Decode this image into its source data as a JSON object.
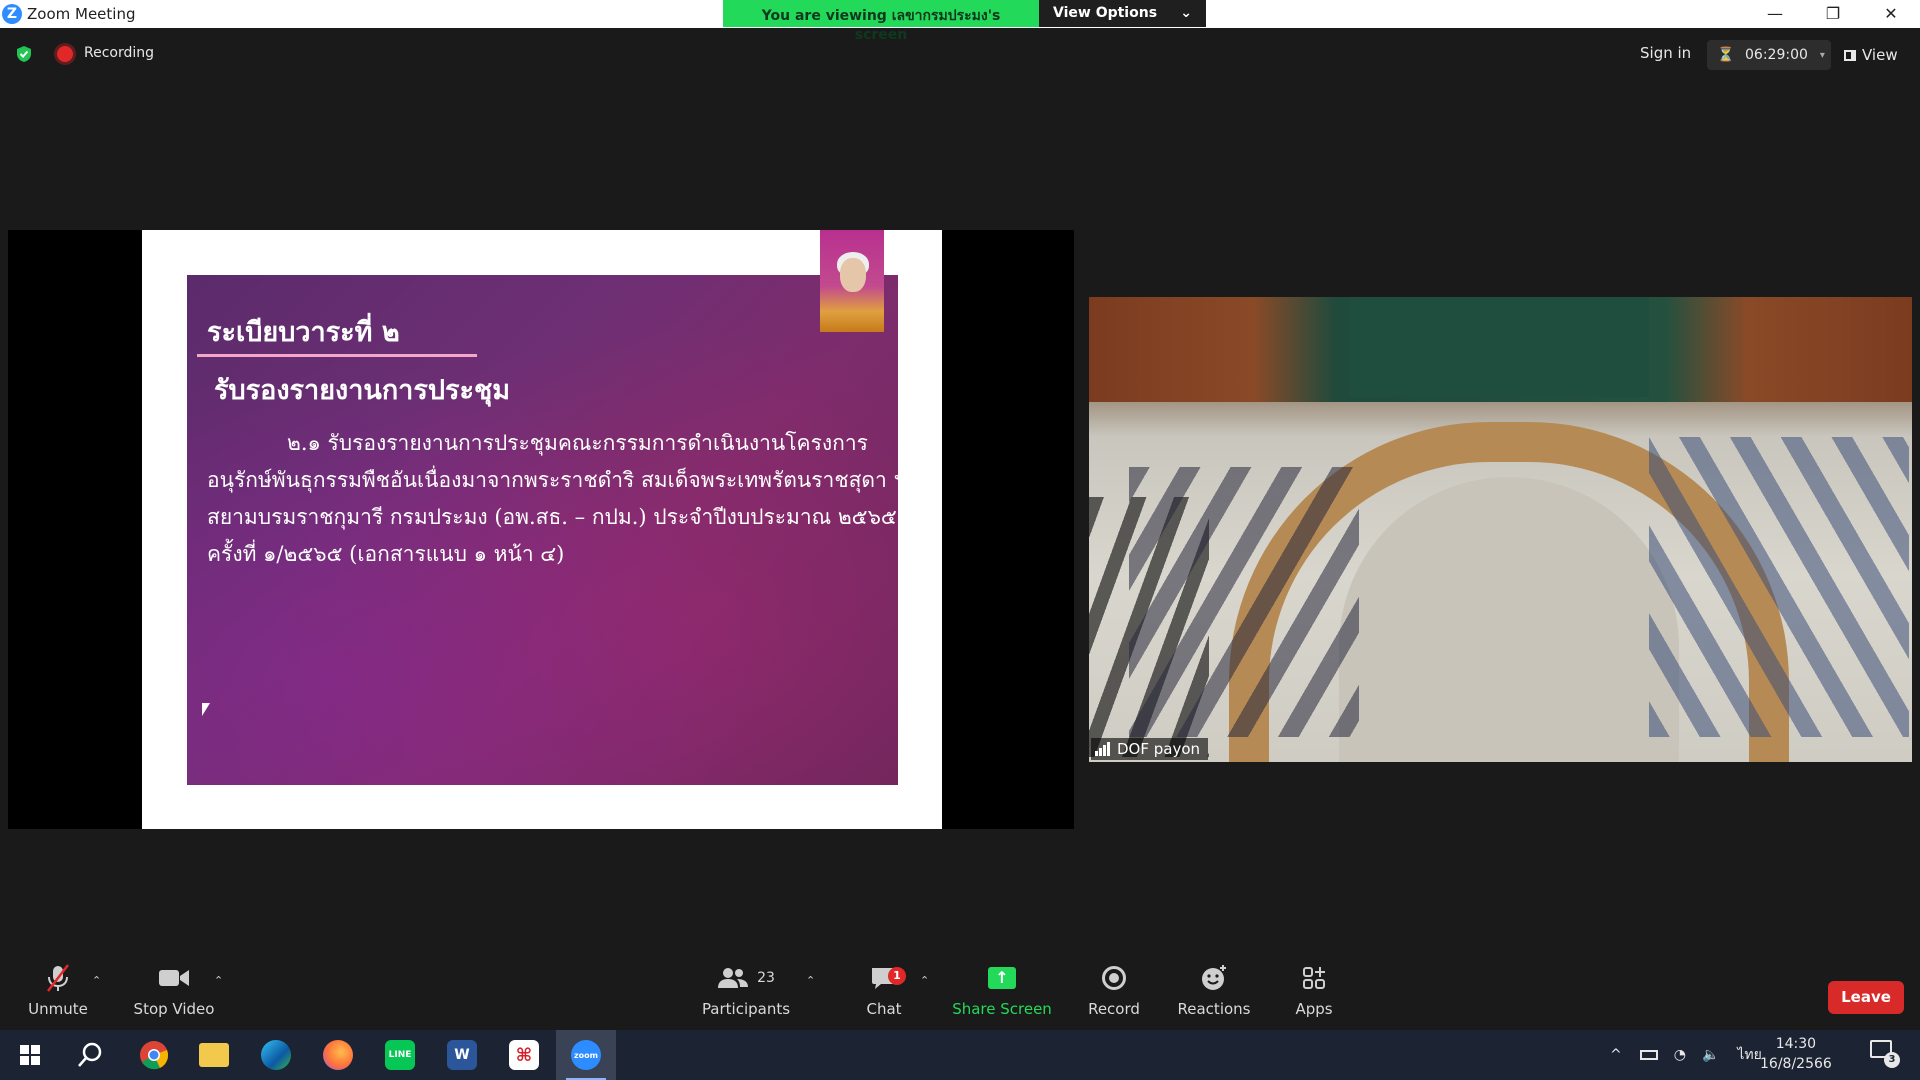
{
  "window": {
    "title": "Zoom Meeting",
    "logo_letter": "Z",
    "controls": {
      "minimize": "—",
      "restore": "❐",
      "close": "✕"
    }
  },
  "share_banner": {
    "text": "You are viewing เลขากรมประมง's screen",
    "view_options": "View Options",
    "caret": "⌄"
  },
  "topbar": {
    "recording_label": "Recording",
    "sign_in": "Sign in",
    "timer": "06:29:00",
    "timer_icon": "⏳",
    "timer_caret": "▾",
    "view_label": "View"
  },
  "slide": {
    "heading": "ระเบียบวาระที่ ๒",
    "subheading": "รับรองรายงานการประชุม",
    "body_lines": [
      "๒.๑ รับรองรายงานการประชุมคณะกรรมการดำเนินงานโครงการ",
      "อนุรักษ์พันธุกรรมพืชอันเนื่องมาจากพระราชดำริ สมเด็จพระเทพรัตนราชสุดา ฯ",
      "สยามบรมราชกุมารี กรมประมง (อพ.สธ. – กปม.) ประจำปีงบประมาณ ๒๕๖๕",
      "ครั้งที่ ๑/๒๕๖๕ (เอกสารแนบ ๑ หน้า ๔)"
    ]
  },
  "video_tile": {
    "participant_name": "DOF payon"
  },
  "toolbar": {
    "unmute": "Unmute",
    "stop_video": "Stop Video",
    "participants": "Participants",
    "participants_count": "23",
    "chat": "Chat",
    "chat_badge": "1",
    "share_screen": "Share Screen",
    "record": "Record",
    "reactions": "Reactions",
    "apps": "Apps",
    "leave": "Leave",
    "caret": "⌃"
  },
  "taskbar": {
    "apps": [
      "Start",
      "Search",
      "Chrome",
      "File Explorer",
      "Edge",
      "Firefox",
      "LINE",
      "Word",
      "Acrobat",
      "Zoom"
    ],
    "tray_caret": "^",
    "language": "ไทย",
    "time": "14:30",
    "date": "16/8/2566",
    "notification_count": "3"
  },
  "colors": {
    "share_green": "#23d959",
    "leave_red": "#d92a2a",
    "zoom_blue": "#2d8cff"
  }
}
